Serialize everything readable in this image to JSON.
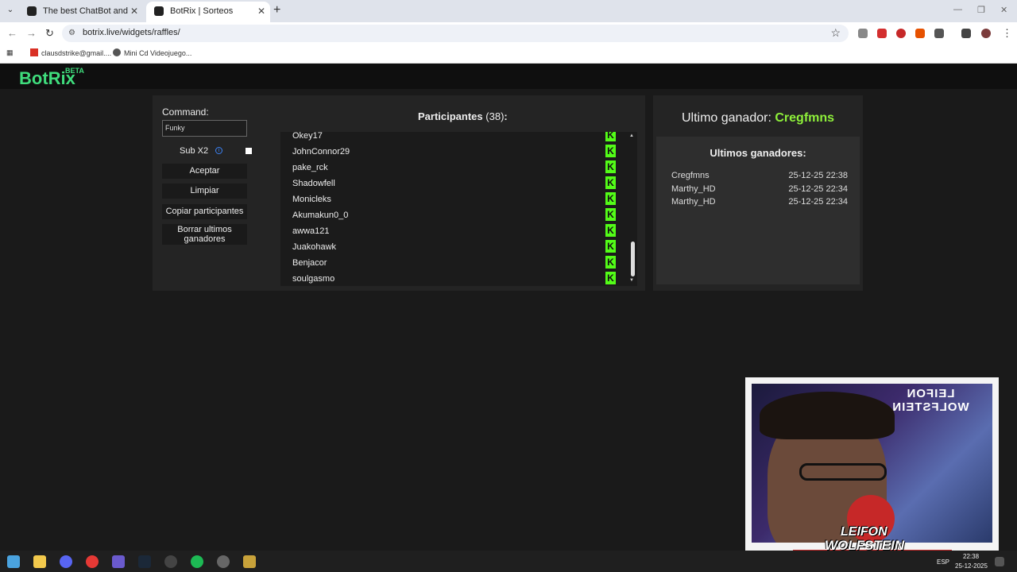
{
  "browser": {
    "tabs": [
      {
        "title": "The best ChatBot and Widgets"
      },
      {
        "title": "BotRix | Sorteos"
      }
    ],
    "url": "botrix.live/widgets/raffles/",
    "bookmarks": [
      {
        "label": "clausdstrike@gmail...."
      },
      {
        "label": "Mini Cd Videojuego..."
      }
    ]
  },
  "site": {
    "logo": "BotRix",
    "beta": "BETA"
  },
  "controls": {
    "command_label": "Command:",
    "command_value": "Funky",
    "sub_label": "Sub X2",
    "aceptar": "Aceptar",
    "limpiar": "Limpiar",
    "copiar": "Copiar participantes",
    "borrar_line1": "Borrar ultimos",
    "borrar_line2": "ganadores"
  },
  "participants": {
    "title": "Participantes",
    "count": "(38)",
    "colon": ":",
    "items": [
      {
        "name": "Okey17",
        "platform": "kick"
      },
      {
        "name": "JohnConnor29",
        "platform": "kick"
      },
      {
        "name": "pake_rck",
        "platform": "kick"
      },
      {
        "name": "Shadowfell",
        "platform": "kick"
      },
      {
        "name": "Monicleks",
        "platform": "kick"
      },
      {
        "name": "Akumakun0_0",
        "platform": "kick"
      },
      {
        "name": "awwa121",
        "platform": "kick"
      },
      {
        "name": "Juakohawk",
        "platform": "kick"
      },
      {
        "name": "Benjacor",
        "platform": "kick"
      },
      {
        "name": "soulgasmo",
        "platform": "kick"
      }
    ],
    "kick_glyph": "K"
  },
  "winners": {
    "last_label": "Ultimo ganador:",
    "last_name": "Cregfmns",
    "list_title": "Ultimos ganadores:",
    "rows": [
      {
        "name": "Cregfmns",
        "date": "25-12-25 22:38"
      },
      {
        "name": "Marthy_HD",
        "date": "25-12-25 22:34"
      },
      {
        "name": "Marthy_HD",
        "date": "25-12-25 22:34"
      }
    ]
  },
  "webcam": {
    "overlay_top": "LEIFON WOLFSTEIN",
    "banner_line1": "LEIFON",
    "banner_line2": "WOLFSTEIN"
  },
  "taskbar": {
    "lang": "ESP",
    "time": "22:38",
    "date": "25-12-2025"
  },
  "colors": {
    "accent_green": "#3fdc7c",
    "kick_green": "#53fc18",
    "winner_green": "#8ef03a"
  }
}
